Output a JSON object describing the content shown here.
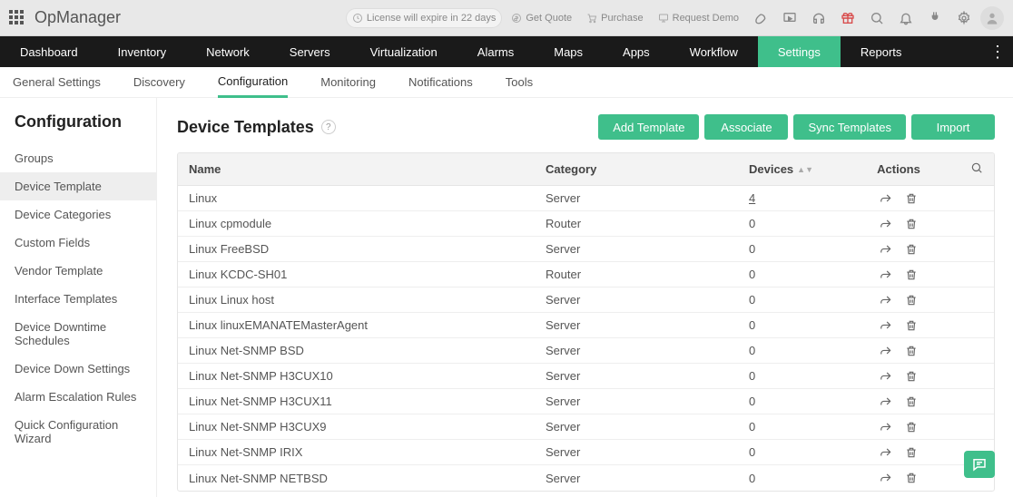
{
  "brand": "OpManager",
  "top_links": {
    "license": "License will expire in 22 days",
    "quote": "Get Quote",
    "purchase": "Purchase",
    "demo": "Request Demo"
  },
  "mainnav": [
    "Dashboard",
    "Inventory",
    "Network",
    "Servers",
    "Virtualization",
    "Alarms",
    "Maps",
    "Apps",
    "Workflow",
    "Settings",
    "Reports"
  ],
  "mainnav_active": "Settings",
  "subnav": [
    "General Settings",
    "Discovery",
    "Configuration",
    "Monitoring",
    "Notifications",
    "Tools"
  ],
  "subnav_active": "Configuration",
  "sidebar": {
    "title": "Configuration",
    "items": [
      "Groups",
      "Device Template",
      "Device Categories",
      "Custom Fields",
      "Vendor Template",
      "Interface Templates",
      "Device Downtime Schedules",
      "Device Down Settings",
      "Alarm Escalation Rules",
      "Quick Configuration Wizard"
    ],
    "active": "Device Template"
  },
  "page_title": "Device Templates",
  "buttons": {
    "add": "Add Template",
    "associate": "Associate",
    "sync": "Sync Templates",
    "import": "Import"
  },
  "columns": {
    "name": "Name",
    "category": "Category",
    "devices": "Devices",
    "actions": "Actions"
  },
  "rows": [
    {
      "name": "Linux",
      "category": "Server",
      "devices": "4",
      "link": true
    },
    {
      "name": "Linux cpmodule",
      "category": "Router",
      "devices": "0"
    },
    {
      "name": "Linux FreeBSD",
      "category": "Server",
      "devices": "0"
    },
    {
      "name": "Linux KCDC-SH01",
      "category": "Router",
      "devices": "0"
    },
    {
      "name": "Linux Linux host",
      "category": "Server",
      "devices": "0"
    },
    {
      "name": "Linux linuxEMANATEMasterAgent",
      "category": "Server",
      "devices": "0"
    },
    {
      "name": "Linux Net-SNMP BSD",
      "category": "Server",
      "devices": "0"
    },
    {
      "name": "Linux Net-SNMP H3CUX10",
      "category": "Server",
      "devices": "0"
    },
    {
      "name": "Linux Net-SNMP H3CUX11",
      "category": "Server",
      "devices": "0"
    },
    {
      "name": "Linux Net-SNMP H3CUX9",
      "category": "Server",
      "devices": "0"
    },
    {
      "name": "Linux Net-SNMP IRIX",
      "category": "Server",
      "devices": "0"
    },
    {
      "name": "Linux Net-SNMP NETBSD",
      "category": "Server",
      "devices": "0"
    }
  ]
}
